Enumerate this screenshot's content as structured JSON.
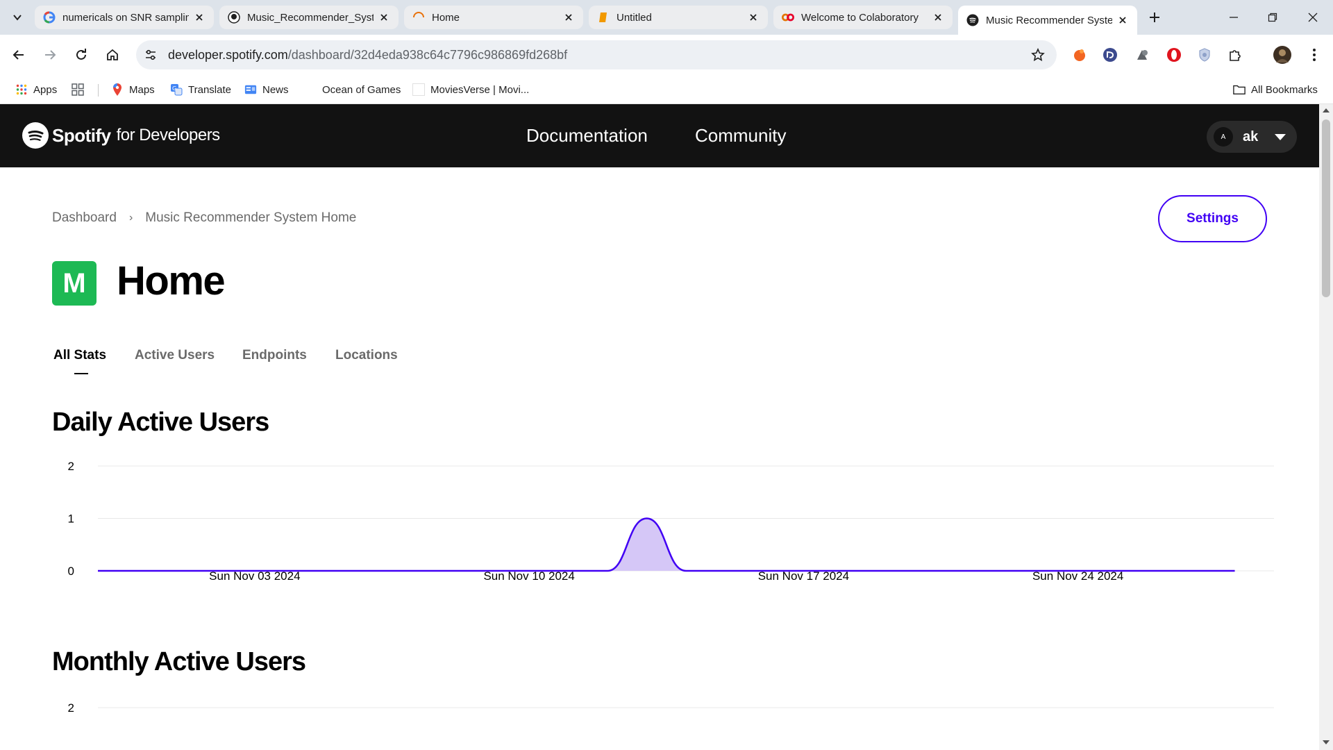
{
  "browser": {
    "tabs": [
      {
        "title": "numericals on SNR samplin",
        "icon": "google-icon",
        "active": false
      },
      {
        "title": "Music_Recommender_Syst",
        "icon": "github-icon",
        "active": false
      },
      {
        "title": "Home",
        "icon": "loading-icon",
        "active": false
      },
      {
        "title": "Untitled",
        "icon": "notebook-icon",
        "active": false
      },
      {
        "title": "Welcome to Colaboratory",
        "icon": "colab-icon",
        "active": false
      },
      {
        "title": "Music Recommender Syste",
        "icon": "spotify-icon",
        "active": true
      }
    ],
    "url_host": "developer.spotify.com",
    "url_path": "/dashboard/32d4eda938c64c7796c986869fd268bf",
    "bookmarks": [
      {
        "label": "Apps",
        "icon": "apps-grid-icon"
      },
      {
        "label": "",
        "icon": "tab-groups-icon"
      },
      {
        "label": "Maps",
        "icon": "maps-pin-icon"
      },
      {
        "label": "Translate",
        "icon": "translate-icon"
      },
      {
        "label": "News",
        "icon": "news-icon"
      },
      {
        "label": "Ocean of Games",
        "icon": ""
      },
      {
        "label": "MoviesVerse | Movi...",
        "icon": "blank-page-icon"
      }
    ],
    "all_bookmarks": "All Bookmarks"
  },
  "header": {
    "brand": "Spotify",
    "brand_suffix": "for Developers",
    "nav": [
      "Documentation",
      "Community"
    ],
    "user_initial": "A",
    "user_name": "ak"
  },
  "page": {
    "breadcrumb": [
      "Dashboard",
      "Music Recommender System Home"
    ],
    "settings_label": "Settings",
    "app_icon_letter": "M",
    "title": "Home",
    "tabs": [
      "All Stats",
      "Active Users",
      "Endpoints",
      "Locations"
    ],
    "active_tab": "All Stats",
    "daily_title": "Daily Active Users",
    "monthly_title": "Monthly Active Users"
  },
  "colors": {
    "accent": "#4100f4",
    "chart_fill": "#d5c7f7",
    "app_icon": "#1db954",
    "header_bg": "#121212"
  },
  "chart_data": [
    {
      "type": "area",
      "title": "Daily Active Users",
      "x": [
        "2024-10-30",
        "2024-11-01",
        "2024-11-03",
        "2024-11-05",
        "2024-11-07",
        "2024-11-09",
        "2024-11-10",
        "2024-11-11",
        "2024-11-12",
        "2024-11-13",
        "2024-11-14",
        "2024-11-15",
        "2024-11-17",
        "2024-11-19",
        "2024-11-21",
        "2024-11-23",
        "2024-11-24",
        "2024-11-26",
        "2024-11-28"
      ],
      "y": [
        0,
        0,
        0,
        0,
        0,
        0,
        0,
        0,
        0,
        1,
        0,
        0,
        0,
        0,
        0,
        0,
        0,
        0,
        0
      ],
      "x_ticks": [
        "Sun Nov 03 2024",
        "Sun Nov 10 2024",
        "Sun Nov 17 2024",
        "Sun Nov 24 2024"
      ],
      "y_ticks": [
        0,
        1,
        2
      ],
      "ylim": [
        0,
        2
      ],
      "xlim": [
        "2024-10-30",
        "2024-11-29"
      ],
      "grid": true
    },
    {
      "type": "area",
      "title": "Monthly Active Users",
      "y_ticks": [
        2
      ],
      "ylim": [
        0,
        2
      ],
      "grid": true
    }
  ]
}
